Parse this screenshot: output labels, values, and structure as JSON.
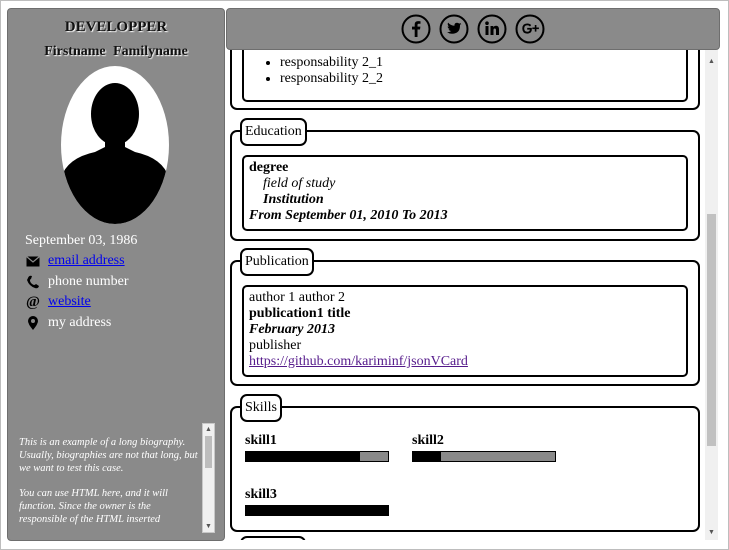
{
  "sidebar": {
    "role": "DEVELOPPER",
    "name": "Firstname  Familyname",
    "birthdate": "September 03, 1986",
    "contacts": [
      {
        "icon": "envelope-icon",
        "text": "email address",
        "link": true
      },
      {
        "icon": "phone-icon",
        "text": "phone number",
        "link": false
      },
      {
        "icon": "at-icon",
        "text": "website",
        "link": true
      },
      {
        "icon": "map-pin-icon",
        "text": "my address",
        "link": false
      }
    ],
    "bio": [
      "This is an example of a long biography. Usually, biographies are not that long, but we want to test this case.",
      "You can use HTML here, and it will function. Since the owner is the responsible of the HTML inserted"
    ]
  },
  "social": [
    "facebook-icon",
    "twitter-icon",
    "linkedin-icon",
    "google-plus-icon"
  ],
  "experience": {
    "responsabilities": [
      "responsability 2_1",
      "responsability 2_2"
    ]
  },
  "education": {
    "legend": "Education",
    "degree": "degree",
    "field": "field of study",
    "institution": "Institution",
    "period": "From September 01, 2010 To 2013"
  },
  "publication": {
    "legend": "Publication",
    "authors": "author 1 author 2",
    "title": "publication1 title",
    "date": "February 2013",
    "publisher": "publisher",
    "url": "https://github.com/kariminf/jsonVCard"
  },
  "skills": {
    "legend": "Skills",
    "items": [
      {
        "name": "skill1",
        "level": 0.8
      },
      {
        "name": "skill2",
        "level": 0.2
      },
      {
        "name": "skill3",
        "level": 1.0
      }
    ]
  },
  "colors": {
    "sidebar": "#8a8a8a",
    "bar_empty": "#8a8a8a",
    "bar_fill": "#000000",
    "link": "#0000ee",
    "visited": "#551a8b"
  }
}
